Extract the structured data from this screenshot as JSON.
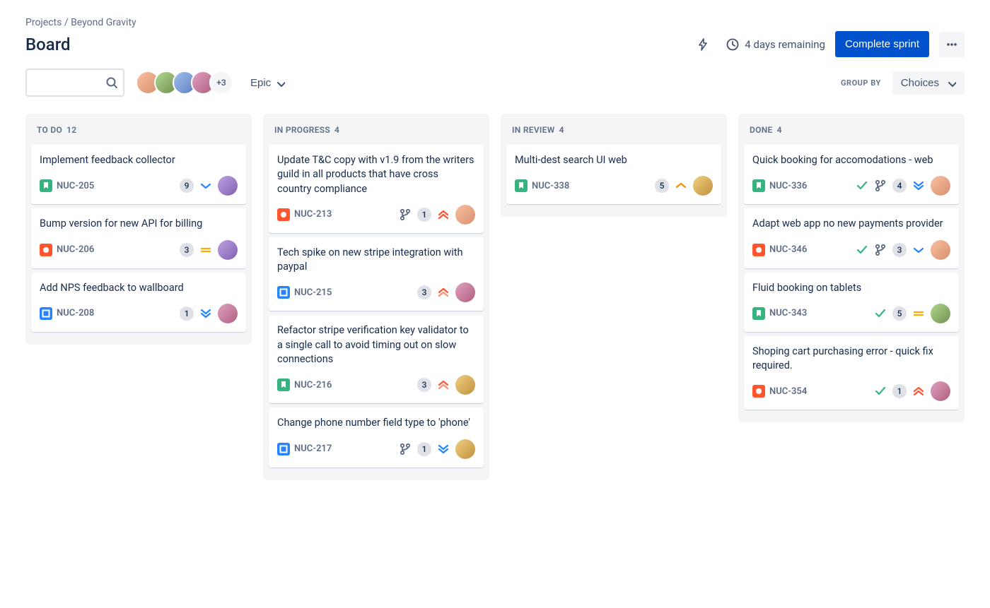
{
  "breadcrumb": {
    "projects": "Projects",
    "project": "Beyond Gravity"
  },
  "title": "Board",
  "header": {
    "remaining": "4 days remaining",
    "complete_sprint": "Complete sprint"
  },
  "toolbar": {
    "epic_label": "Epic",
    "avatar_more": "+3",
    "group_by_label": "GROUP BY",
    "group_by_value": "Choices"
  },
  "columns": [
    {
      "name": "TO DO",
      "count": "12"
    },
    {
      "name": "IN PROGRESS",
      "count": "4"
    },
    {
      "name": "IN REVIEW",
      "count": "4"
    },
    {
      "name": "DONE",
      "count": "4"
    }
  ],
  "cards": {
    "c0": {
      "title": "Implement feedback collector",
      "key": "NUC-205",
      "points": "9",
      "type": "story",
      "priority": "low",
      "avatar": "av-f"
    },
    "c1": {
      "title": "Bump version for new API for billing",
      "key": "NUC-206",
      "points": "3",
      "type": "bug",
      "priority": "medium",
      "avatar": "av-f"
    },
    "c2": {
      "title": "Add NPS feedback to wallboard",
      "key": "NUC-208",
      "points": "1",
      "type": "task",
      "priority": "lowest",
      "avatar": "av-d"
    },
    "c3": {
      "title": "Update T&C copy with v1.9 from the writers guild in all products that have cross country compliance",
      "key": "NUC-213",
      "points": "1",
      "type": "bug",
      "priority": "highest",
      "avatar": "av-a",
      "branch": true
    },
    "c4": {
      "title": "Tech spike on new stripe integration with paypal",
      "key": "NUC-215",
      "points": "3",
      "type": "task",
      "priority": "high",
      "avatar": "av-d"
    },
    "c5": {
      "title": "Refactor stripe verification key validator to a single call to avoid timing out on slow connections",
      "key": "NUC-216",
      "points": "3",
      "type": "story",
      "priority": "high",
      "avatar": "av-e"
    },
    "c6": {
      "title": "Change phone number field type to 'phone'",
      "key": "NUC-217",
      "points": "1",
      "type": "task",
      "priority": "lowest",
      "avatar": "av-e",
      "branch": true
    },
    "c7": {
      "title": "Multi-dest search UI web",
      "key": "NUC-338",
      "points": "5",
      "type": "story",
      "priority": "high-orange",
      "avatar": "av-e"
    },
    "c8": {
      "title": "Quick booking for accomodations - web",
      "key": "NUC-336",
      "points": "4",
      "type": "story",
      "priority": "lowest",
      "avatar": "av-a",
      "done": true,
      "branch": true
    },
    "c9": {
      "title": "Adapt web app no new payments provider",
      "key": "NUC-346",
      "points": "3",
      "type": "bug",
      "priority": "low",
      "avatar": "av-a",
      "done": true,
      "branch": true
    },
    "c10": {
      "title": "Fluid booking on tablets",
      "key": "NUC-343",
      "points": "5",
      "type": "story",
      "priority": "medium",
      "avatar": "av-b",
      "done": true
    },
    "c11": {
      "title": "Shoping cart purchasing error - quick fix required.",
      "key": "NUC-354",
      "points": "1",
      "type": "bug",
      "priority": "highest",
      "avatar": "av-d",
      "done": true
    }
  }
}
